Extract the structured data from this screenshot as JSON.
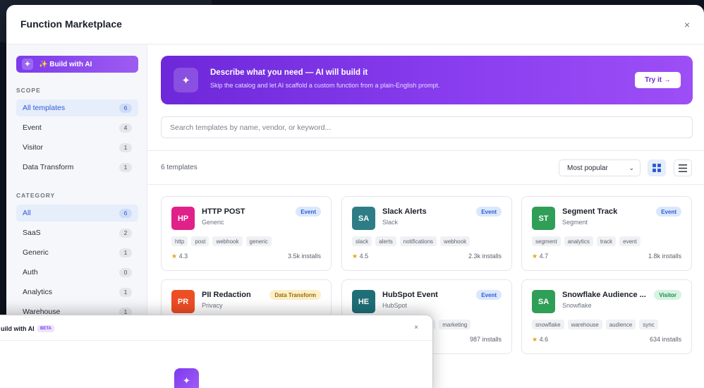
{
  "modal": {
    "title": "Function Marketplace",
    "close": "×"
  },
  "sidebar": {
    "build_ai": {
      "icon": "sparkle-icon",
      "label": "✨ Build with AI"
    },
    "scope_label": "SCOPE",
    "scope": [
      {
        "label": "All templates",
        "count": "6",
        "active": true
      },
      {
        "label": "Event",
        "count": "4"
      },
      {
        "label": "Visitor",
        "count": "1"
      },
      {
        "label": "Data Transform",
        "count": "1"
      }
    ],
    "category_label": "CATEGORY",
    "category": [
      {
        "label": "All",
        "count": "6",
        "active": true
      },
      {
        "label": "SaaS",
        "count": "2"
      },
      {
        "label": "Generic",
        "count": "1"
      },
      {
        "label": "Auth",
        "count": "0"
      },
      {
        "label": "Analytics",
        "count": "1"
      },
      {
        "label": "Warehouse",
        "count": "1"
      }
    ]
  },
  "banner": {
    "title": "Describe what you need — AI will build it",
    "subtitle": "Skip the catalog and let AI scaffold a custom function from a plain-English prompt.",
    "button": "Try it →"
  },
  "search": {
    "placeholder": "Search templates by name, vendor, or keyword..."
  },
  "toolbar": {
    "count": "6 templates",
    "sort": "Most popular"
  },
  "cards": [
    {
      "initials": "HP",
      "color": "#e0218a",
      "name": "HTTP POST",
      "vendor": "Generic",
      "badge": "Event",
      "tags": [
        "http",
        "post",
        "webhook",
        "generic"
      ],
      "rating": "4.3",
      "installs": "3.5k installs"
    },
    {
      "initials": "SA",
      "color": "#2e7d86",
      "name": "Slack Alerts",
      "vendor": "Slack",
      "badge": "Event",
      "tags": [
        "slack",
        "alerts",
        "notifications",
        "webhook"
      ],
      "rating": "4.5",
      "installs": "2.3k installs"
    },
    {
      "initials": "ST",
      "color": "#2f9e57",
      "name": "Segment Track",
      "vendor": "Segment",
      "badge": "Event",
      "tags": [
        "segment",
        "analytics",
        "track",
        "event"
      ],
      "rating": "4.7",
      "installs": "1.8k installs"
    },
    {
      "initials": "PR",
      "color": "#ee4e24",
      "name": "PII Redaction",
      "vendor": "Privacy",
      "badge": "Data Transform",
      "tags": [],
      "rating": "",
      "installs": ""
    },
    {
      "initials": "HE",
      "color": "#1f6f78",
      "name": "HubSpot Event",
      "vendor": "HubSpot",
      "badge": "Event",
      "tags": [
        "t",
        "marketing"
      ],
      "rating": "",
      "installs": "987 installs"
    },
    {
      "initials": "SA",
      "color": "#2f9e57",
      "name": "Snowflake Audience ...",
      "vendor": "Snowflake",
      "badge": "Visitor",
      "tags": [
        "snowflake",
        "warehouse",
        "audience",
        "sync"
      ],
      "rating": "4.6",
      "installs": "634 installs"
    }
  ],
  "popup": {
    "title": "uild with AI",
    "beta": "BETA",
    "close": "×"
  }
}
